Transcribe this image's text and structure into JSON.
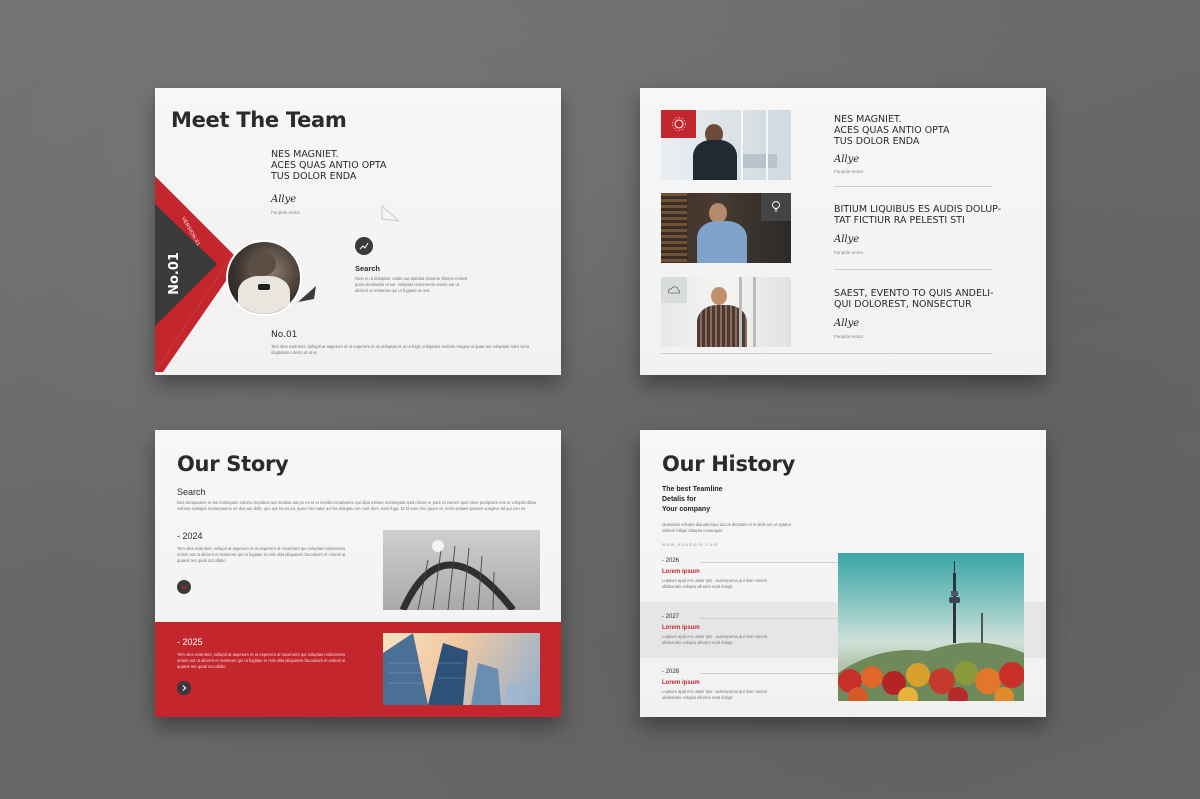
{
  "slides": {
    "team": {
      "title": "Meet The Team",
      "heading_lines": [
        "NES MAGNIET.",
        "ACES QUAS ANTIO OPTA",
        "TUS DOLOR ENDA"
      ],
      "signature": "Allye",
      "signature_caption": "Fanpide entics",
      "version": "VERSION.01",
      "number_vertical": "No.01",
      "search_label": "Search",
      "search_text": "Nost et ut doluptas, undis aut apediat dusaner liberes molest quos simtinasto ut ius, voluptas moloreestu omnis aut ut alicient et resterum qui ut fugitate ut rest",
      "number_label": "No.01",
      "number_text": "Tem oles essinteni, sollupit at asperum et ut experent et as doluptas et ut ut fugit, voluptatet moloriu magna ut quae aut voluptate nam verio oluptatemo derro ut ut et."
    },
    "members": {
      "rows": [
        {
          "heading": [
            "NES MAGNIET.",
            "ACES QUAS ANTIO OPTA",
            "TUS DOLOR ENDA"
          ],
          "signature": "Allye",
          "caption": "Fanpide entics"
        },
        {
          "heading": [
            "BITIUM LIQUIBUS ES AUDIS DOLUP-",
            "TAT FICTIUR RA PELESTI STI"
          ],
          "signature": "Allye",
          "caption": "Fanpide entics"
        },
        {
          "heading": [
            "SAEST, EVENTO TO QUIS ANDELI-",
            "QUI DOLOREST, NONSECTUR"
          ],
          "signature": "Allye",
          "caption": "Fanpide entics"
        }
      ]
    },
    "story": {
      "title": "Our Story",
      "search_label": "Search",
      "search_text": "Dus temquatem re las moloquam volorru mquibus aut modias aut pe ex et et venitis necaborem qui ulpa estiore nonsequist quid nimos re pore ut estrum quis nime pedipsam eos et voluptis ditae volorep ratisque nonsequanni as dus aut dolit, quo aut ea ex ea, quos nos natur ad ma dolupta con cust dem, nam fuga. Et id eum imo quam ut, nosit optiaes ipsuam voluptur ad qui con ex",
      "year_1": "- 2024",
      "year_1_text": "Tem oles essinteni, sollupit at asperum et ut experent ut maximent qui voluptas moloreestu omnis aut ut alicient et resterum qui ut fugitate in rest alita pliquatem faccaborit et volenit ut quaest res quati occullabo",
      "year_2": "- 2025",
      "year_2_text": "Tem oles essinteni, sollupit at asperum et ut experent ut maximent qui voluptas moloreestu omnis aut ut alicient et resterum qui ut fugitate in rest alita pliquatem faccaborit et volenit ut quaest res quati occullabo"
    },
    "history": {
      "title": "Our History",
      "subtitle_lines": [
        "The best Teamline",
        "Detalis for",
        "Your company"
      ],
      "intro_text": "Quiandas volupta diquatemqui accus dictatem si is delis ius ut optatur velitem hiliqui dolupta nonsequis",
      "url": "w w w . e x a m p l e . c o m",
      "events": [
        {
          "year": "- 2026",
          "label": "Lorem ipsum",
          "text": "Luptium apid ero utasir ipis - autemporsa qui isse nonest ullaboratio volupta ullorem eost dolupt"
        },
        {
          "year": "- 2027",
          "label": "Lorem ipsum",
          "text": "Luptium apid ero utasir ipis - autemporsa qui isse nonest ullaboratio volupta ullorem eost dolupt"
        },
        {
          "year": "- 2028",
          "label": "Lorem ipsum",
          "text": "Luptium apid ero utasir ipis - autemporsa qui isse nonest ullaboratio volupta ullorem eost dolupt"
        }
      ]
    }
  },
  "colors": {
    "accent": "#c4262e",
    "dark": "#3a3a3a",
    "background": "#6b6b6b"
  },
  "icons": [
    "chart-icon",
    "arrow-down-icon",
    "arrow-right-icon",
    "lightbulb-icon",
    "cloud-icon",
    "sun-icon"
  ]
}
